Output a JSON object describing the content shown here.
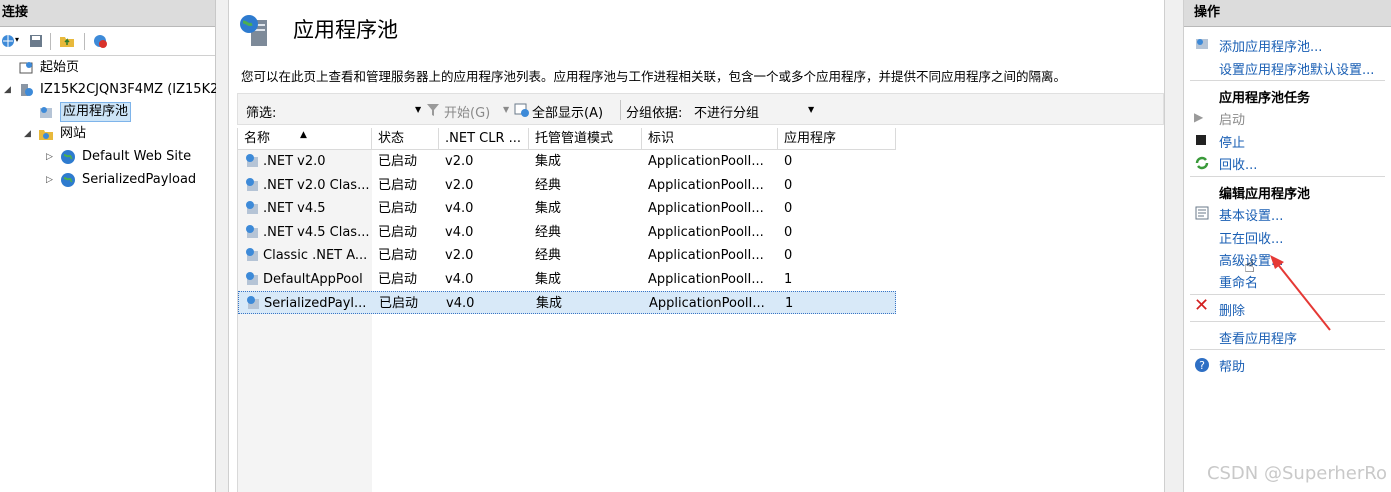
{
  "left_panel": {
    "header": "连接",
    "tree": {
      "start_page": "起始页",
      "server": "IZ15K2CJQN3F4MZ (IZ15K2",
      "app_pools": "应用程序池",
      "sites": "网站",
      "site1": "Default Web Site",
      "site2": "SerializedPayload"
    }
  },
  "center": {
    "title": "应用程序池",
    "description": "您可以在此页上查看和管理服务器上的应用程序池列表。应用程序池与工作进程相关联，包含一个或多个应用程序，并提供不同应用程序之间的隔离。",
    "filter": {
      "label": "筛选:",
      "value": "",
      "start": "开始(G)",
      "show_all": "全部显示(A)",
      "group_by_label": "分组依据:",
      "group_by_value": "不进行分组"
    },
    "columns": [
      "名称",
      "状态",
      ".NET CLR ...",
      "托管管道模式",
      "标识",
      "应用程序"
    ],
    "rows": [
      {
        "name": ".NET v2.0",
        "status": "已启动",
        "clr": "v2.0",
        "mode": "集成",
        "identity": "ApplicationPoolI...",
        "apps": "0"
      },
      {
        "name": ".NET v2.0 Clas...",
        "status": "已启动",
        "clr": "v2.0",
        "mode": "经典",
        "identity": "ApplicationPoolI...",
        "apps": "0"
      },
      {
        "name": ".NET v4.5",
        "status": "已启动",
        "clr": "v4.0",
        "mode": "集成",
        "identity": "ApplicationPoolI...",
        "apps": "0"
      },
      {
        "name": ".NET v4.5 Clas...",
        "status": "已启动",
        "clr": "v4.0",
        "mode": "经典",
        "identity": "ApplicationPoolI...",
        "apps": "0"
      },
      {
        "name": "Classic .NET A...",
        "status": "已启动",
        "clr": "v2.0",
        "mode": "经典",
        "identity": "ApplicationPoolI...",
        "apps": "0"
      },
      {
        "name": "DefaultAppPool",
        "status": "已启动",
        "clr": "v4.0",
        "mode": "集成",
        "identity": "ApplicationPoolI...",
        "apps": "1"
      },
      {
        "name": "SerializedPayl...",
        "status": "已启动",
        "clr": "v4.0",
        "mode": "集成",
        "identity": "ApplicationPoolI...",
        "apps": "1"
      }
    ]
  },
  "actions": {
    "header": "操作",
    "add_pool": "添加应用程序池...",
    "set_defaults": "设置应用程序池默认设置...",
    "tasks_header": "应用程序池任务",
    "start": "启动",
    "stop": "停止",
    "recycle": "回收...",
    "edit_header": "编辑应用程序池",
    "basic": "基本设置...",
    "recycling": "正在回收...",
    "advanced": "高级设置...",
    "rename": "重命名",
    "delete": "删除",
    "view_apps": "查看应用程序",
    "help": "帮助"
  },
  "watermark": "CSDN @SuperherRo",
  "colors": {
    "link": "#1a5fb4",
    "selection": "#d8e9f8",
    "header_bg": "#dcdcdc",
    "arrow": "#e53935"
  }
}
